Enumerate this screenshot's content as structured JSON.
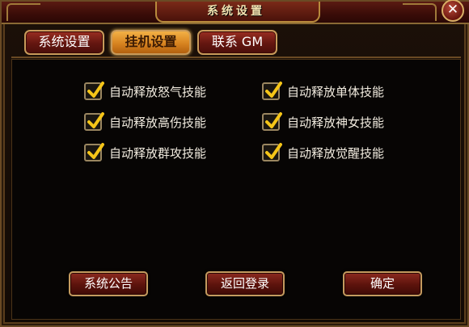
{
  "window": {
    "title": "系统设置",
    "close_label": "✕"
  },
  "tabs": [
    {
      "label": "系统设置",
      "active": false
    },
    {
      "label": "挂机设置",
      "active": true
    },
    {
      "label": "联系 GM",
      "active": false
    }
  ],
  "options": [
    {
      "label": "自动释放怒气技能",
      "checked": true
    },
    {
      "label": "自动释放单体技能",
      "checked": true
    },
    {
      "label": "自动释放高伤技能",
      "checked": true
    },
    {
      "label": "自动释放神女技能",
      "checked": true
    },
    {
      "label": "自动释放群攻技能",
      "checked": true
    },
    {
      "label": "自动释放觉醒技能",
      "checked": true
    }
  ],
  "buttons": {
    "announcement": "系统公告",
    "back_to_login": "返回登录",
    "confirm": "确定"
  },
  "colors": {
    "check_mark": "#f5c518",
    "active_tab": "#e09a30",
    "button": "#6a1810"
  }
}
